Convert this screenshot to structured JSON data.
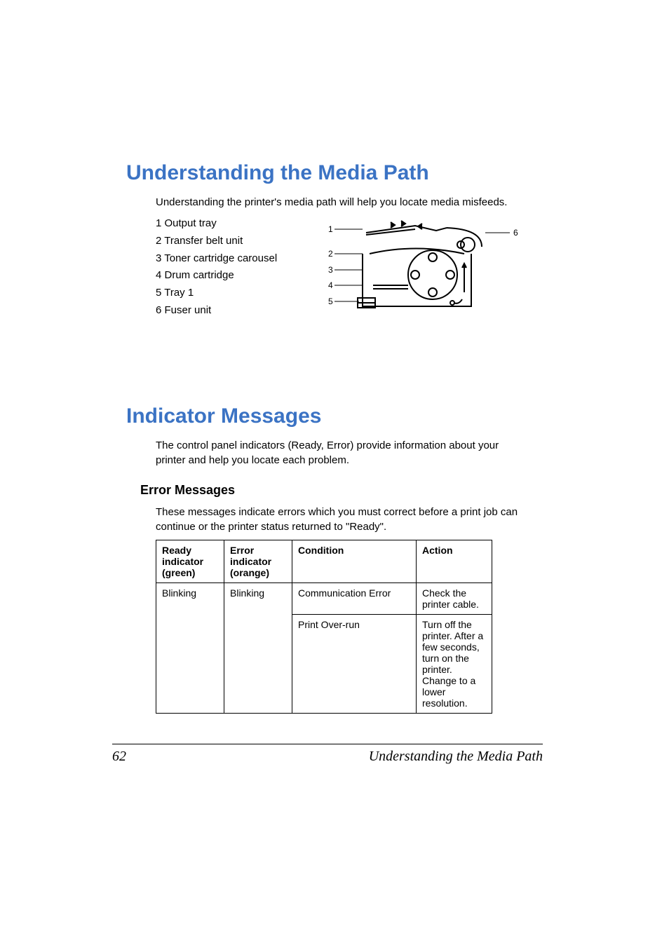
{
  "section1": {
    "heading": "Understanding the Media Path",
    "intro": "Understanding the printer's media path will help you locate media misfeeds.",
    "items": [
      "1 Output tray",
      "2 Transfer belt unit",
      "3 Toner cartridge carousel",
      "4 Drum cartridge",
      "5 Tray 1",
      "6 Fuser unit"
    ],
    "diagram_labels": {
      "l1": "1",
      "l2": "2",
      "l3": "3",
      "l4": "4",
      "l5": "5",
      "l6": "6"
    }
  },
  "section2": {
    "heading": "Indicator Messages",
    "intro": "The control panel indicators (Ready, Error) provide information about your printer and help you locate each problem.",
    "sub_heading": "Error Messages",
    "sub_intro": "These messages indicate errors which you must correct before a print job can continue or the printer status returned to \"Ready\".",
    "table": {
      "headers": {
        "ready": "Ready indicator (green)",
        "error": "Error indicator (orange)",
        "condition": "Condition",
        "action": "Action"
      },
      "rows": [
        {
          "ready": "Blinking",
          "error": "Blinking",
          "condition": "Communication Error",
          "action": "Check the printer cable."
        },
        {
          "condition": "Print Over-run",
          "action": "Turn off the printer. After a few seconds, turn on the printer. Change to a lower resolution."
        }
      ]
    }
  },
  "footer": {
    "page_number": "62",
    "title": "Understanding the Media Path"
  }
}
